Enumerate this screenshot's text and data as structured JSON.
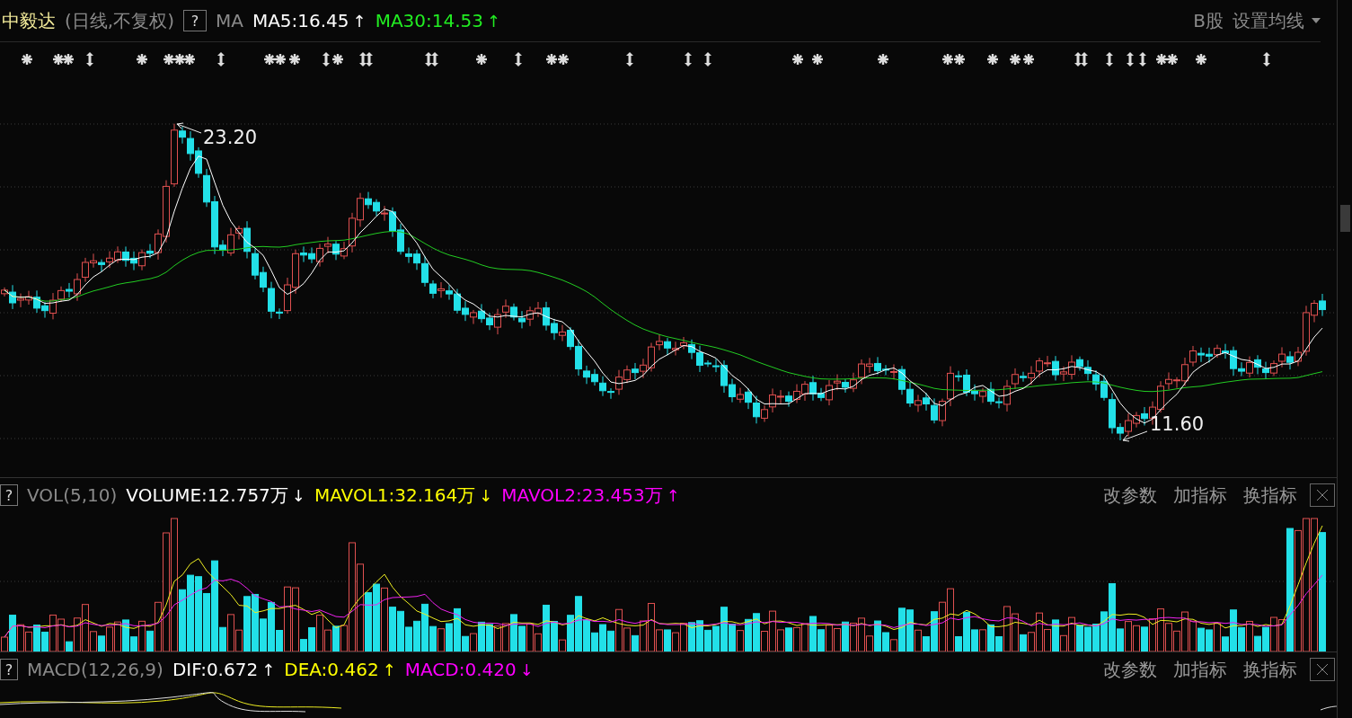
{
  "header": {
    "stock_name": "中毅达",
    "period": "(日线,不复权)",
    "help": "?",
    "indicator": "MA",
    "readings": [
      {
        "text": "MA5:16.45",
        "trend": "↑",
        "color": "#ffffff"
      },
      {
        "text": "MA30:14.53",
        "trend": "↑",
        "color": "#22ee22"
      }
    ],
    "market": "B股",
    "ma_settings": "设置均线"
  },
  "price_chart": {
    "high_label": "23.20",
    "low_label": "11.60"
  },
  "panels": [
    {
      "kind": "volume",
      "help": "?",
      "indicator": "VOL(5,10)",
      "readings": [
        {
          "text": "VOLUME:12.757万",
          "trend": "↓",
          "color": "#ffffff"
        },
        {
          "text": "MAVOL1:32.164万",
          "trend": "↓",
          "color": "#ffff00"
        },
        {
          "text": "MAVOL2:23.453万",
          "trend": "↑",
          "color": "#ff00ff"
        }
      ],
      "actions": [
        "改参数",
        "加指标",
        "换指标"
      ]
    },
    {
      "kind": "macd",
      "help": "?",
      "indicator": "MACD(12,26,9)",
      "readings": [
        {
          "text": "DIF:0.672",
          "trend": "↑",
          "color": "#ffffff"
        },
        {
          "text": "DEA:0.462",
          "trend": "↑",
          "color": "#ffff00"
        },
        {
          "text": "MACD:0.420",
          "trend": "↓",
          "color": "#ff00ff"
        }
      ],
      "actions": [
        "改参数",
        "加指标",
        "换指标"
      ]
    }
  ]
}
